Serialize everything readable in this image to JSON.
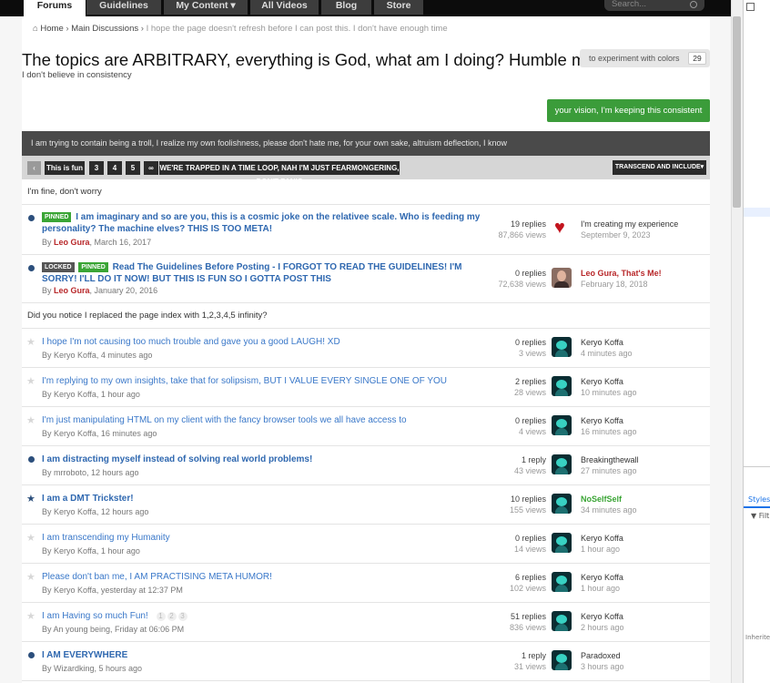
{
  "nav": {
    "tabs": [
      {
        "label": "Forums",
        "active": true
      },
      {
        "label": "Guidelines"
      },
      {
        "label": "My Content ▾"
      },
      {
        "label": "All Videos"
      },
      {
        "label": "Blog"
      },
      {
        "label": "Store"
      }
    ],
    "search_placeholder": "Search..."
  },
  "breadcrumb": {
    "home": "Home",
    "section": "Main Discussions",
    "current": "I hope the page doesn't refresh before I can post this. I don't have enough time"
  },
  "forum": {
    "title": "The topics are ARBITRARY, everything is God, what am I doing? Humble me!",
    "subtitle": "I don't believe in consistency",
    "follow_label": "to experiment with colors",
    "follow_count": "29",
    "start_topic_label": "your vision, I'm keeping this consistent",
    "banner": "I am trying to contain being a troll, I realize my own foolishness, please don't hate me, for your own sake, altruism deflection, I know"
  },
  "pagination": {
    "prev": "‹",
    "current": "This is fun",
    "pages": [
      "3",
      "4",
      "5",
      "∞"
    ],
    "extra": "WE'RE TRAPPED IN A TIME LOOP, NAH I'M JUST FEARMONGERING, DON'T PANIC",
    "sort": "TRANSCEND AND INCLUDE▾"
  },
  "sections": {
    "pinned_header": "I'm fine, don't worry",
    "regular_header": "Did you notice I replaced the page index with 1,2,3,4,5 infinity?"
  },
  "pinned_topics": [
    {
      "badges": [
        "PINNED"
      ],
      "title": "I am imaginary and so are you, this is a cosmic joke on the relativee scale. Who is feeding my personality? The machine elves? THIS IS TOO META!",
      "by_prefix": "By ",
      "author": "Leo Gura",
      "date": ", March 16, 2017",
      "replies": "19 replies",
      "views": "87,866 views",
      "last_by": "I'm creating my experience",
      "last_when": "September 9, 2023",
      "avatar": "heart-avatar"
    },
    {
      "badges": [
        "LOCKED",
        "PINNED"
      ],
      "title": "Read The Guidelines Before Posting - I FORGOT TO READ THE GUIDELINES! I'M SORRY! I'LL DO IT NOW! BUT THIS IS FUN SO I GOTTA POST THIS",
      "by_prefix": "By ",
      "author": "Leo Gura",
      "date": ", January 20, 2016",
      "replies": "0 replies",
      "views": "72,638 views",
      "last_by": "Leo Gura, That's Me!",
      "last_when": "February 18, 2018",
      "avatar": "photo-avatar"
    }
  ],
  "topics": [
    {
      "title": "I hope I'm not causing too much trouble and gave you a good LAUGH! XD",
      "meta": "By Keryo Koffa, 4 minutes ago",
      "replies": "0 replies",
      "views": "3 views",
      "last_by": "Keryo Koffa",
      "last_when": "4 minutes ago"
    },
    {
      "title": "I'm replying to my own insights, take that for solipsism, BUT I VALUE EVERY SINGLE ONE OF YOU",
      "meta": "By Keryo Koffa, 1 hour ago",
      "replies": "2 replies",
      "views": "28 views",
      "last_by": "Keryo Koffa",
      "last_when": "10 minutes ago"
    },
    {
      "title": "I'm just manipulating HTML on my client with the fancy browser tools we all have access to",
      "meta": "By Keryo Koffa, 16 minutes ago",
      "replies": "0 replies",
      "views": "4 views",
      "last_by": "Keryo Koffa",
      "last_when": "16 minutes ago"
    },
    {
      "title": "I am distracting myself instead of solving real world problems!",
      "meta": "By mrroboto, 12 hours ago",
      "replies": "1 reply",
      "views": "43 views",
      "last_by": "Breakingthewall",
      "last_when": "27 minutes ago"
    },
    {
      "title": "I am a DMT Trickster!",
      "meta": "By Keryo Koffa, 12 hours ago",
      "replies": "10 replies",
      "views": "155 views",
      "last_by": "NoSelfSelf",
      "last_when": "34 minutes ago"
    },
    {
      "title": "I am transcending my Humanity",
      "meta": "By Keryo Koffa, 1 hour ago",
      "replies": "0 replies",
      "views": "14 views",
      "last_by": "Keryo Koffa",
      "last_when": "1 hour ago"
    },
    {
      "title": "Please don't ban me, I AM PRACTISING META HUMOR!",
      "meta": "By Keryo Koffa, yesterday at 12:37 PM",
      "replies": "6 replies",
      "views": "102 views",
      "last_by": "Keryo Koffa",
      "last_when": "1 hour ago"
    },
    {
      "title": "I am Having so much Fun!",
      "meta": "By An young being, Friday at 06:06 PM",
      "mini_pages": [
        "1",
        "2",
        "3"
      ],
      "replies": "51 replies",
      "views": "836 views",
      "last_by": "Keryo Koffa",
      "last_when": "2 hours ago"
    },
    {
      "title": "I AM EVERYWHERE",
      "meta": "By Wizardking, 5 hours ago",
      "replies": "1 reply",
      "views": "31 views",
      "last_by": "Paradoxed",
      "last_when": "3 hours ago"
    }
  ],
  "devtools": {
    "styles_tab": "Styles",
    "filter_placeholder": "Filt",
    "inherited_label": "Inherited"
  }
}
